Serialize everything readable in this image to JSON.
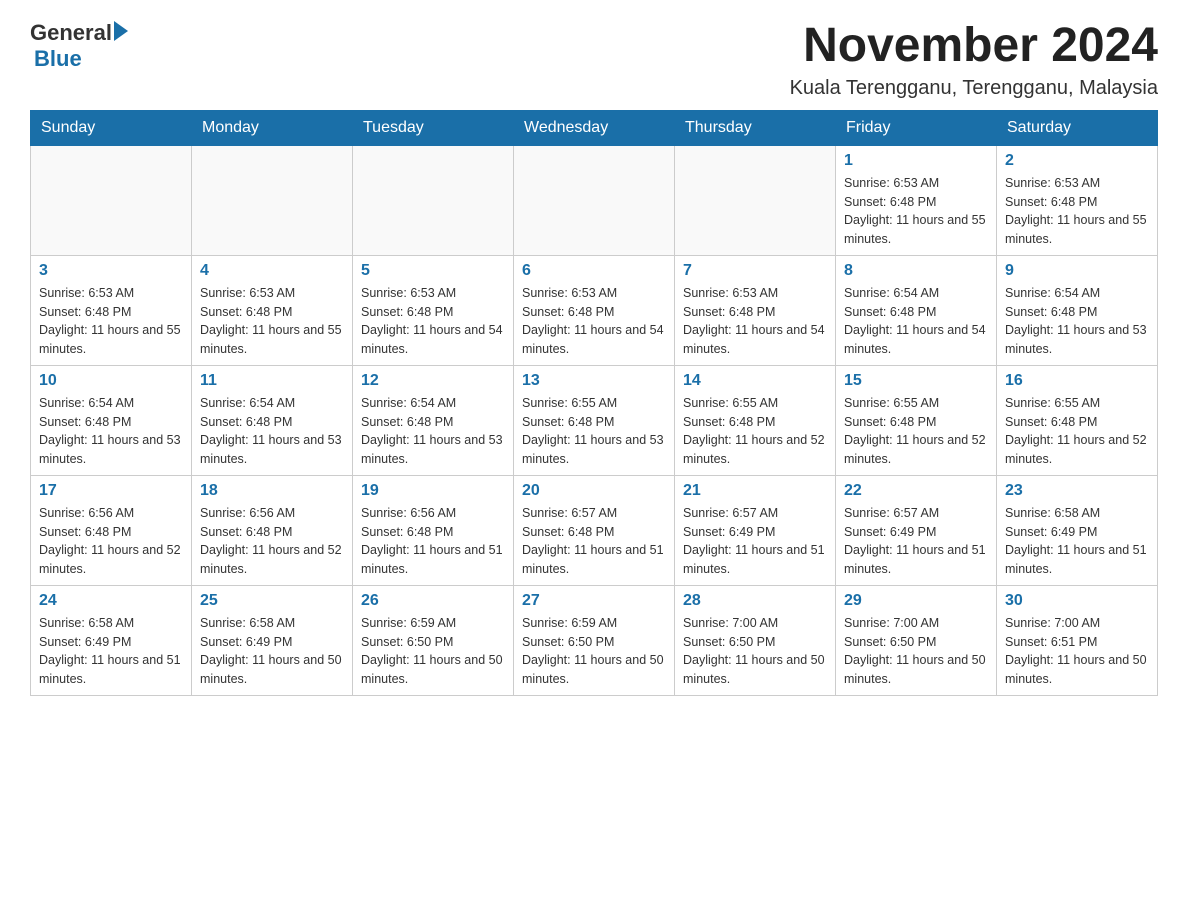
{
  "logo": {
    "general": "General",
    "blue": "Blue"
  },
  "header": {
    "title": "November 2024",
    "subtitle": "Kuala Terengganu, Terengganu, Malaysia"
  },
  "weekdays": [
    "Sunday",
    "Monday",
    "Tuesday",
    "Wednesday",
    "Thursday",
    "Friday",
    "Saturday"
  ],
  "weeks": [
    [
      {
        "day": "",
        "sunrise": "",
        "sunset": "",
        "daylight": ""
      },
      {
        "day": "",
        "sunrise": "",
        "sunset": "",
        "daylight": ""
      },
      {
        "day": "",
        "sunrise": "",
        "sunset": "",
        "daylight": ""
      },
      {
        "day": "",
        "sunrise": "",
        "sunset": "",
        "daylight": ""
      },
      {
        "day": "",
        "sunrise": "",
        "sunset": "",
        "daylight": ""
      },
      {
        "day": "1",
        "sunrise": "Sunrise: 6:53 AM",
        "sunset": "Sunset: 6:48 PM",
        "daylight": "Daylight: 11 hours and 55 minutes."
      },
      {
        "day": "2",
        "sunrise": "Sunrise: 6:53 AM",
        "sunset": "Sunset: 6:48 PM",
        "daylight": "Daylight: 11 hours and 55 minutes."
      }
    ],
    [
      {
        "day": "3",
        "sunrise": "Sunrise: 6:53 AM",
        "sunset": "Sunset: 6:48 PM",
        "daylight": "Daylight: 11 hours and 55 minutes."
      },
      {
        "day": "4",
        "sunrise": "Sunrise: 6:53 AM",
        "sunset": "Sunset: 6:48 PM",
        "daylight": "Daylight: 11 hours and 55 minutes."
      },
      {
        "day": "5",
        "sunrise": "Sunrise: 6:53 AM",
        "sunset": "Sunset: 6:48 PM",
        "daylight": "Daylight: 11 hours and 54 minutes."
      },
      {
        "day": "6",
        "sunrise": "Sunrise: 6:53 AM",
        "sunset": "Sunset: 6:48 PM",
        "daylight": "Daylight: 11 hours and 54 minutes."
      },
      {
        "day": "7",
        "sunrise": "Sunrise: 6:53 AM",
        "sunset": "Sunset: 6:48 PM",
        "daylight": "Daylight: 11 hours and 54 minutes."
      },
      {
        "day": "8",
        "sunrise": "Sunrise: 6:54 AM",
        "sunset": "Sunset: 6:48 PM",
        "daylight": "Daylight: 11 hours and 54 minutes."
      },
      {
        "day": "9",
        "sunrise": "Sunrise: 6:54 AM",
        "sunset": "Sunset: 6:48 PM",
        "daylight": "Daylight: 11 hours and 53 minutes."
      }
    ],
    [
      {
        "day": "10",
        "sunrise": "Sunrise: 6:54 AM",
        "sunset": "Sunset: 6:48 PM",
        "daylight": "Daylight: 11 hours and 53 minutes."
      },
      {
        "day": "11",
        "sunrise": "Sunrise: 6:54 AM",
        "sunset": "Sunset: 6:48 PM",
        "daylight": "Daylight: 11 hours and 53 minutes."
      },
      {
        "day": "12",
        "sunrise": "Sunrise: 6:54 AM",
        "sunset": "Sunset: 6:48 PM",
        "daylight": "Daylight: 11 hours and 53 minutes."
      },
      {
        "day": "13",
        "sunrise": "Sunrise: 6:55 AM",
        "sunset": "Sunset: 6:48 PM",
        "daylight": "Daylight: 11 hours and 53 minutes."
      },
      {
        "day": "14",
        "sunrise": "Sunrise: 6:55 AM",
        "sunset": "Sunset: 6:48 PM",
        "daylight": "Daylight: 11 hours and 52 minutes."
      },
      {
        "day": "15",
        "sunrise": "Sunrise: 6:55 AM",
        "sunset": "Sunset: 6:48 PM",
        "daylight": "Daylight: 11 hours and 52 minutes."
      },
      {
        "day": "16",
        "sunrise": "Sunrise: 6:55 AM",
        "sunset": "Sunset: 6:48 PM",
        "daylight": "Daylight: 11 hours and 52 minutes."
      }
    ],
    [
      {
        "day": "17",
        "sunrise": "Sunrise: 6:56 AM",
        "sunset": "Sunset: 6:48 PM",
        "daylight": "Daylight: 11 hours and 52 minutes."
      },
      {
        "day": "18",
        "sunrise": "Sunrise: 6:56 AM",
        "sunset": "Sunset: 6:48 PM",
        "daylight": "Daylight: 11 hours and 52 minutes."
      },
      {
        "day": "19",
        "sunrise": "Sunrise: 6:56 AM",
        "sunset": "Sunset: 6:48 PM",
        "daylight": "Daylight: 11 hours and 51 minutes."
      },
      {
        "day": "20",
        "sunrise": "Sunrise: 6:57 AM",
        "sunset": "Sunset: 6:48 PM",
        "daylight": "Daylight: 11 hours and 51 minutes."
      },
      {
        "day": "21",
        "sunrise": "Sunrise: 6:57 AM",
        "sunset": "Sunset: 6:49 PM",
        "daylight": "Daylight: 11 hours and 51 minutes."
      },
      {
        "day": "22",
        "sunrise": "Sunrise: 6:57 AM",
        "sunset": "Sunset: 6:49 PM",
        "daylight": "Daylight: 11 hours and 51 minutes."
      },
      {
        "day": "23",
        "sunrise": "Sunrise: 6:58 AM",
        "sunset": "Sunset: 6:49 PM",
        "daylight": "Daylight: 11 hours and 51 minutes."
      }
    ],
    [
      {
        "day": "24",
        "sunrise": "Sunrise: 6:58 AM",
        "sunset": "Sunset: 6:49 PM",
        "daylight": "Daylight: 11 hours and 51 minutes."
      },
      {
        "day": "25",
        "sunrise": "Sunrise: 6:58 AM",
        "sunset": "Sunset: 6:49 PM",
        "daylight": "Daylight: 11 hours and 50 minutes."
      },
      {
        "day": "26",
        "sunrise": "Sunrise: 6:59 AM",
        "sunset": "Sunset: 6:50 PM",
        "daylight": "Daylight: 11 hours and 50 minutes."
      },
      {
        "day": "27",
        "sunrise": "Sunrise: 6:59 AM",
        "sunset": "Sunset: 6:50 PM",
        "daylight": "Daylight: 11 hours and 50 minutes."
      },
      {
        "day": "28",
        "sunrise": "Sunrise: 7:00 AM",
        "sunset": "Sunset: 6:50 PM",
        "daylight": "Daylight: 11 hours and 50 minutes."
      },
      {
        "day": "29",
        "sunrise": "Sunrise: 7:00 AM",
        "sunset": "Sunset: 6:50 PM",
        "daylight": "Daylight: 11 hours and 50 minutes."
      },
      {
        "day": "30",
        "sunrise": "Sunrise: 7:00 AM",
        "sunset": "Sunset: 6:51 PM",
        "daylight": "Daylight: 11 hours and 50 minutes."
      }
    ]
  ]
}
